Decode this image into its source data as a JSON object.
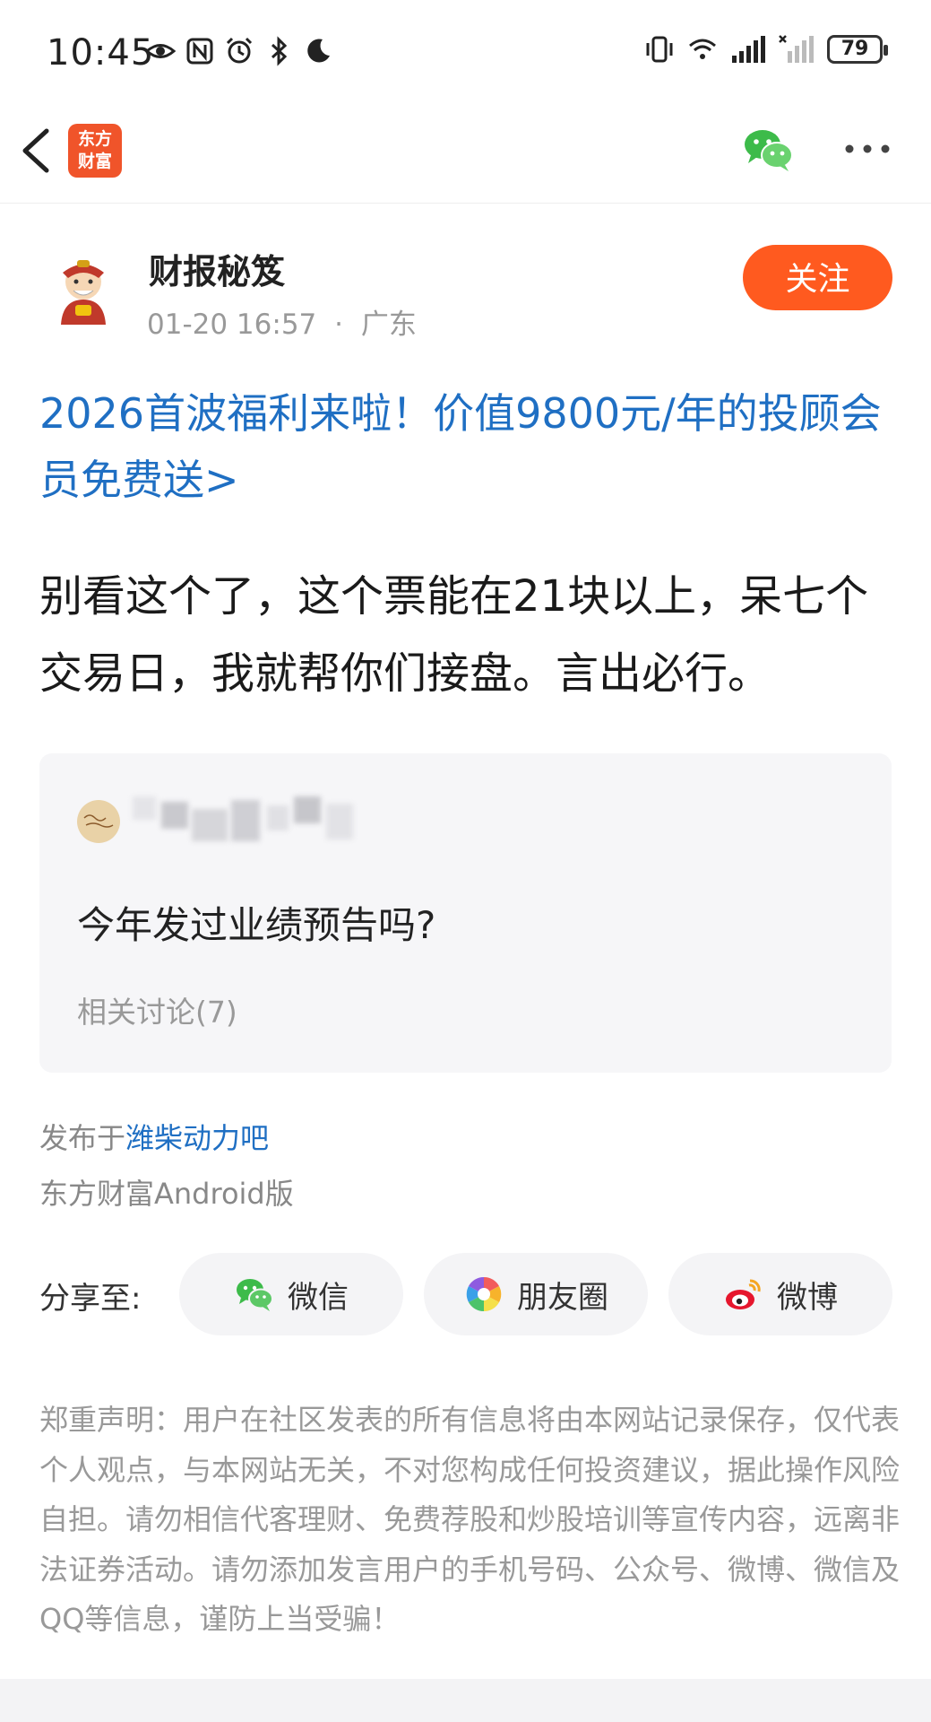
{
  "status_bar": {
    "time": "10:45",
    "battery": "79"
  },
  "header": {
    "logo_text_line1": "东方",
    "logo_text_line2": "财富",
    "brand_color": "#f0542a"
  },
  "author": {
    "name": "财报秘笈",
    "date": "01-20 16:57",
    "separator": "·",
    "location": "广东",
    "follow_label": "关注",
    "follow_color": "#ff5a1f"
  },
  "promo": {
    "text": "2026首波福利来啦！价值9800元/年的投顾会员免费送>",
    "color": "#1f6fc3"
  },
  "post": {
    "body": "别看这个了，这个票能在21块以上，呆七个交易日，我就帮你们接盘。言出必行。"
  },
  "quote": {
    "question": "今年发过业绩预告吗?",
    "related": "相关讨论(7)"
  },
  "publish": {
    "prefix": "发布于",
    "bar_name": "潍柴动力吧",
    "app_version": "东方财富Android版"
  },
  "share": {
    "label": "分享至:",
    "wechat": "微信",
    "moments": "朋友圈",
    "weibo": "微博"
  },
  "disclaimer": {
    "text": "郑重声明：用户在社区发表的所有信息将由本网站记录保存，仅代表个人观点，与本网站无关，不对您构成任何投资建议，据此操作风险自担。请勿相信代客理财、免费荐股和炒股培训等宣传内容，远离非法证券活动。请勿添加发言用户的手机号码、公众号、微博、微信及QQ等信息，谨防上当受骗！"
  }
}
